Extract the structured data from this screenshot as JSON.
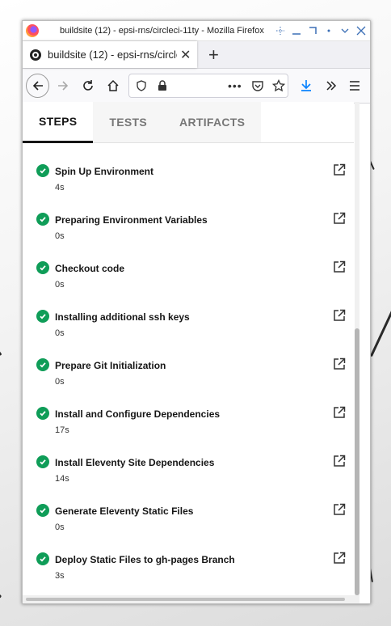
{
  "window": {
    "title": "buildsite (12) - epsi-rns/circleci-11ty - Mozilla Firefox"
  },
  "browser_tab": {
    "title": "buildsite (12) - epsi-rns/circleci-11ty",
    "close": "✕",
    "new_tab": "+"
  },
  "toolbar": {
    "url_dots": "•••"
  },
  "content_tabs": [
    {
      "label": "STEPS",
      "active": true
    },
    {
      "label": "TESTS",
      "active": false
    },
    {
      "label": "ARTIFACTS",
      "active": false
    }
  ],
  "steps": [
    {
      "name": "Spin Up Environment",
      "duration": "4s",
      "status": "success"
    },
    {
      "name": "Preparing Environment Variables",
      "duration": "0s",
      "status": "success"
    },
    {
      "name": "Checkout code",
      "duration": "0s",
      "status": "success"
    },
    {
      "name": "Installing additional ssh keys",
      "duration": "0s",
      "status": "success"
    },
    {
      "name": "Prepare Git Initialization",
      "duration": "0s",
      "status": "success"
    },
    {
      "name": "Install and Configure Dependencies",
      "duration": "17s",
      "status": "success"
    },
    {
      "name": "Install Eleventy Site Dependencies",
      "duration": "14s",
      "status": "success"
    },
    {
      "name": "Generate Eleventy Static Files",
      "duration": "0s",
      "status": "success"
    },
    {
      "name": "Deploy Static Files to gh-pages Branch",
      "duration": "3s",
      "status": "success"
    }
  ],
  "colors": {
    "success": "#0f9d58",
    "download": "#0a84ff"
  }
}
